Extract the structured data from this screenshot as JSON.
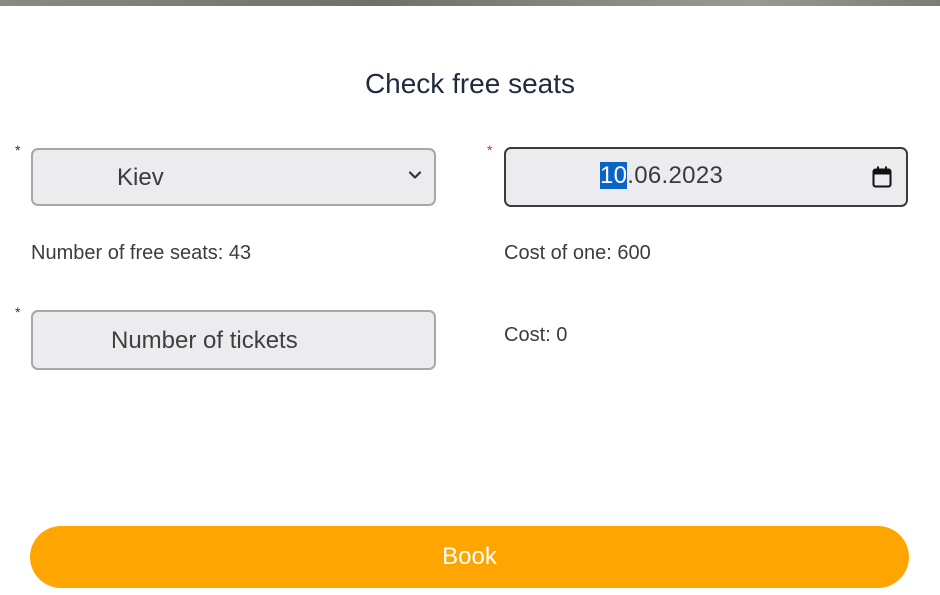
{
  "modal": {
    "title": "Check free seats"
  },
  "form": {
    "required_marker": "*",
    "city": {
      "selected": "Kiev"
    },
    "date": {
      "day": "10",
      "rest": ".06.2023"
    },
    "tickets": {
      "placeholder": "Number of tickets"
    },
    "free_seats_text": "Number of free seats: 43",
    "cost_one_text": "Cost of one: 600",
    "cost_text": "Cost: 0"
  },
  "actions": {
    "book_label": "Book"
  },
  "colors": {
    "accent": "#ffa501",
    "date_highlight": "#0a64c8",
    "required_red": "#d9302c"
  },
  "icons": {
    "select": "chevron-down-icon",
    "date": "calendar-icon"
  }
}
